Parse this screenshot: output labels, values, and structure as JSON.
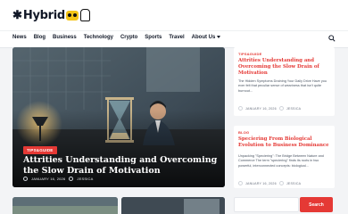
{
  "brand": {
    "logo_name": "hybrid-logo"
  },
  "nav": {
    "items": [
      "News",
      "Blog",
      "Business",
      "Technology",
      "Crypto",
      "Sports",
      "Travel"
    ],
    "about_label": "About Us"
  },
  "hero": {
    "badge": "TIPS&GUIDE",
    "title": "Attrities Understanding and Overcoming the Slow Drain of Motivation",
    "date": "JANUARY 16, 2026",
    "author": "JESSICA"
  },
  "cards": [
    {
      "category": "TIPS&GUIDE",
      "title": "Attrities Understanding and Overcoming the Slow Drain of Motivation",
      "excerpt": "The Hidden Symptoms Draining Your Daily Drive Have you ever felt that peculiar sense of weariness that isn't quite burnout...",
      "date": "JANUARY 16, 2026",
      "author": "JESSICA"
    },
    {
      "category": "BLOG",
      "title": "Speciering From Biological Evolution to Business Dominance",
      "excerpt": "Unpacking \"Speciering\": The Bridge Between Nature and Commerce The term \"speciering\" finds its roots in two powerful, interconnected concepts: biological...",
      "date": "JANUARY 16, 2026",
      "author": "JESSICA"
    }
  ],
  "subscribe": {
    "button_label": "Search"
  },
  "colors": {
    "accent": "#e53935",
    "logo_yellow": "#f5c518"
  }
}
